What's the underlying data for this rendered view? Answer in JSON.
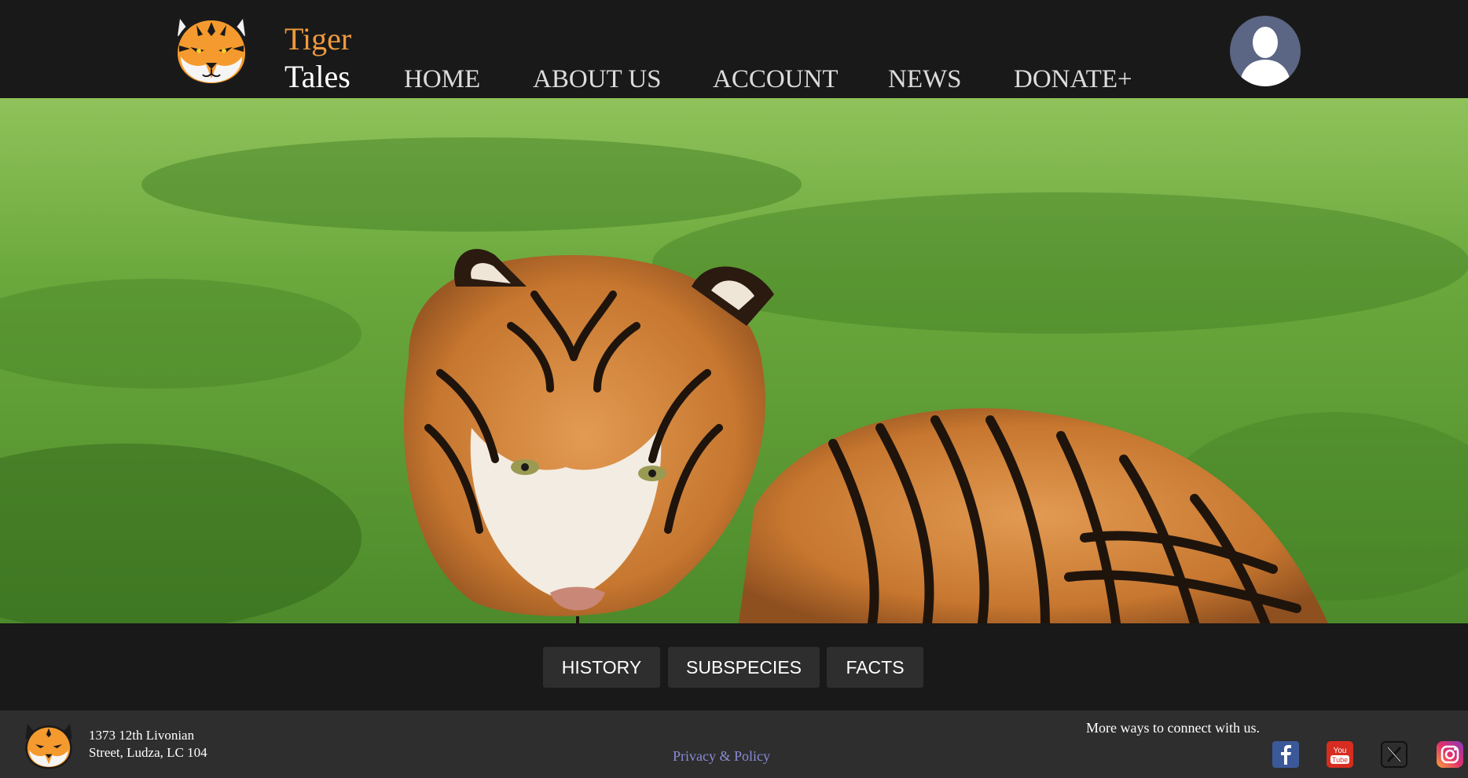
{
  "brand": {
    "line1": "Tiger",
    "line2": "Tales"
  },
  "nav": {
    "home": "HOME",
    "about": "ABOUT US",
    "account": "ACCOUNT",
    "news": "NEWS",
    "donate": "DONATE+"
  },
  "tabs": {
    "history": "HISTORY",
    "subspecies": "SUBSPECIES",
    "facts": "FACTS"
  },
  "footer": {
    "address_line1": "1373 12th Livonian",
    "address_line2": "Street, Ludza, LC 104",
    "privacy": "Privacy & Policy",
    "connect": "More ways to connect with us."
  },
  "icons": {
    "logo": "tiger-head-icon",
    "avatar": "user-avatar-icon",
    "facebook": "facebook-icon",
    "youtube": "youtube-icon",
    "x": "x-icon",
    "instagram": "instagram-icon"
  },
  "colors": {
    "background": "#191919",
    "brand_accent": "#ee9a3e",
    "button_bg": "#2e2e2e",
    "link": "#8a8ad6"
  }
}
